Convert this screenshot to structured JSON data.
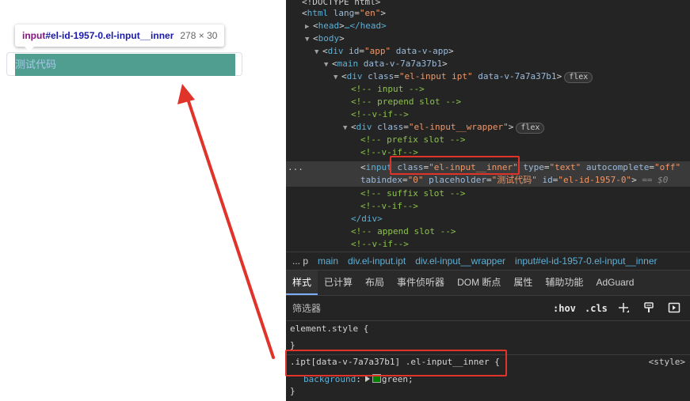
{
  "preview": {
    "tooltip": {
      "tag": "input",
      "id": "#el-id-1957-0.el-input__inner",
      "size": "278 × 30"
    },
    "input": {
      "placeholder": "测试代码"
    },
    "colors": {
      "input_background": "#4f9e90",
      "annotation": "#e0332a"
    }
  },
  "dom": {
    "doctype": "<!DOCTYPE html>",
    "html_tag": "html",
    "html_attr": "lang",
    "html_val": "\"en\"",
    "head_tag": "head",
    "head_ellipsis": "…</head>",
    "body_tag": "body",
    "app_tag": "div",
    "app_attr1": "id",
    "app_val1": "\"app\"",
    "app_attr2": "data-v-app",
    "main_tag": "main",
    "main_attr": "data-v-7a7a37b1",
    "div1_tag": "div",
    "div1_attr": "class",
    "div1_val": "\"el-input ipt\"",
    "div1_attr2": "data-v-7a7a37b1",
    "badge_flex": "flex",
    "c_input": "<!-- input -->",
    "c_prepend": "<!-- prepend slot -->",
    "c_vif": "<!--v-if-->",
    "div2_tag": "div",
    "div2_attr": "class",
    "div2_val": "\"el-input__wrapper\"",
    "c_prefix": "<!-- prefix slot -->",
    "input_tag": "input",
    "input_class_attr": "class",
    "input_class_val": "\"el-input__inner\"",
    "input_type_attr": "type",
    "input_type_val": "\"text\"",
    "input_ac_attr": "autocomplete",
    "input_ac_val": "\"off\"",
    "input_ti_attr": "tabindex",
    "input_ti_val": "\"0\"",
    "input_ph_attr": "placeholder",
    "input_ph_val": "\"测试代码\"",
    "input_id_attr": "id",
    "input_id_val": "\"el-id-1957-0\"",
    "input_suffix": "== $0",
    "c_suffix": "<!-- suffix slot -->",
    "div_close": "</div>",
    "c_append": "<!-- append slot -->",
    "dots": "..."
  },
  "breadcrumbs": {
    "lead": "... p",
    "items": [
      "main",
      "div.el-input.ipt",
      "div.el-input__wrapper",
      "input#el-id-1957-0.el-input__inner"
    ]
  },
  "tabs": [
    "样式",
    "已计算",
    "布局",
    "事件侦听器",
    "DOM 断点",
    "属性",
    "辅助功能",
    "AdGuard"
  ],
  "filter": {
    "placeholder": "筛选器",
    "hov": ":hov",
    "cls": ".cls"
  },
  "styles": {
    "element_style": "element.style {",
    "close_brace": "}",
    "rule_selector": ".ipt[data-v-7a7a37b1] .el-input__inner {",
    "rule_source": "<style>",
    "prop_name": "background",
    "prop_value": "green;"
  }
}
